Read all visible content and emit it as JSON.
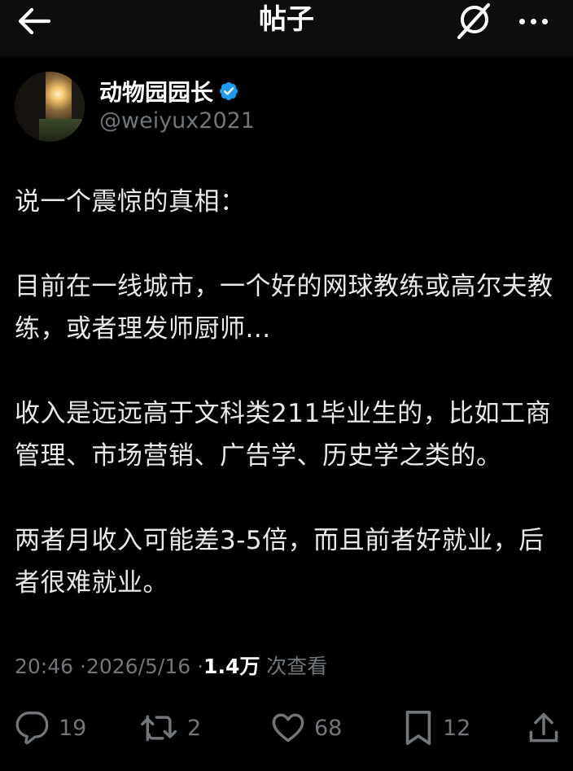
{
  "header": {
    "title": "帖子",
    "back_icon": "arrow-left-icon",
    "grok_icon": "grok-icon",
    "more_icon": "more-horizontal-icon"
  },
  "author": {
    "display_name": "动物园园长",
    "handle": "@weiyux2021",
    "verified": true,
    "verified_color": "#1d9bf0"
  },
  "post": {
    "paragraphs": [
      "说一个震惊的真相：",
      "目前在一线城市，一个好的网球教练或高尔夫教练，或者理发师厨师...",
      "收入是远远高于文科类211毕业生的，比如工商管理、市场营销、广告学、历史学之类的。",
      "两者月收入可能差3-5倍，而且前者好就业，后者很难就业。"
    ]
  },
  "meta": {
    "time": "20:46",
    "date": "2026/5/16",
    "separator": "·",
    "views_count": "1.4万",
    "views_label": "次查看"
  },
  "actions": {
    "replies": "19",
    "reposts": "2",
    "likes": "68",
    "bookmarks": "12"
  },
  "colors": {
    "background": "#000000",
    "header_background": "#0d0d0d",
    "text": "#e7e9ea",
    "secondary_text": "#71767b"
  }
}
